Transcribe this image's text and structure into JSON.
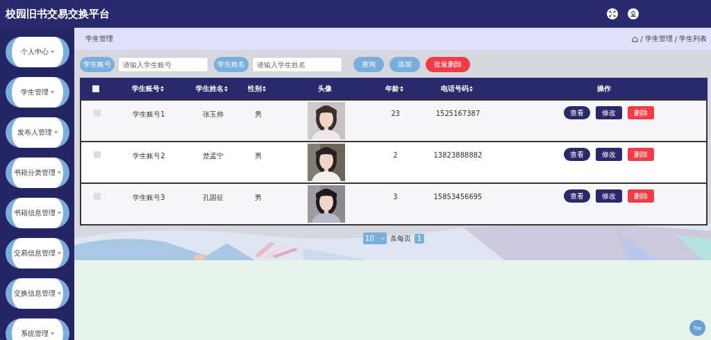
{
  "app_title": "校园旧书交易交换平台",
  "sidebar": {
    "items": [
      {
        "label": "个人中心"
      },
      {
        "label": "学生管理"
      },
      {
        "label": "发布人管理"
      },
      {
        "label": "书籍分类管理"
      },
      {
        "label": "书籍信息管理"
      },
      {
        "label": "交易信息管理"
      },
      {
        "label": "交换信息管理"
      },
      {
        "label": "系统管理"
      }
    ]
  },
  "breadcrumb": {
    "title": "学生管理",
    "separator": "/",
    "path": [
      "学生管理",
      "学生列表"
    ]
  },
  "search": {
    "fields": [
      {
        "label": "学生账号",
        "placeholder": "请输入学生账号"
      },
      {
        "label": "学生姓名",
        "placeholder": "请输入学生姓名"
      }
    ],
    "buttons": [
      {
        "label": "查询",
        "kind": "primary"
      },
      {
        "label": "添加",
        "kind": "primary"
      },
      {
        "label": "批量删除",
        "kind": "danger"
      }
    ]
  },
  "table": {
    "select_all": {
      "checked": false
    },
    "columns": [
      {
        "label": "学生账号",
        "sortable": true
      },
      {
        "label": "学生姓名",
        "sortable": true
      },
      {
        "label": "性别",
        "sortable": true
      },
      {
        "label": "头像",
        "sortable": false
      },
      {
        "label": "年龄",
        "sortable": true
      },
      {
        "label": "电话号码",
        "sortable": true
      },
      {
        "label": "操作",
        "sortable": false
      }
    ],
    "rows": [
      {
        "checked": false,
        "account": "学生账号1",
        "name": "张玉帅",
        "gender": "男",
        "age": "23",
        "phone": "1525167387",
        "actions": [
          {
            "label": "查看",
            "kind": "view"
          },
          {
            "label": "修改",
            "kind": "edit"
          },
          {
            "label": "删除",
            "kind": "delete"
          }
        ]
      },
      {
        "checked": false,
        "account": "学生账号2",
        "name": "楚孟宁",
        "gender": "男",
        "age": "2",
        "phone": "13823888882",
        "actions": [
          {
            "label": "查看",
            "kind": "view"
          },
          {
            "label": "修改",
            "kind": "edit"
          },
          {
            "label": "删除",
            "kind": "delete"
          }
        ]
      },
      {
        "checked": false,
        "account": "学生账号3",
        "name": "孔固征",
        "gender": "男",
        "age": "3",
        "phone": "15853456695",
        "actions": [
          {
            "label": "查看",
            "kind": "view"
          },
          {
            "label": "修改",
            "kind": "edit"
          },
          {
            "label": "删除",
            "kind": "delete"
          }
        ]
      }
    ]
  },
  "pagination": {
    "page_size": "10",
    "page_size_label": "条每页",
    "pages": [
      {
        "label": "1",
        "selected": true
      }
    ]
  },
  "back_to_top": "Top"
}
